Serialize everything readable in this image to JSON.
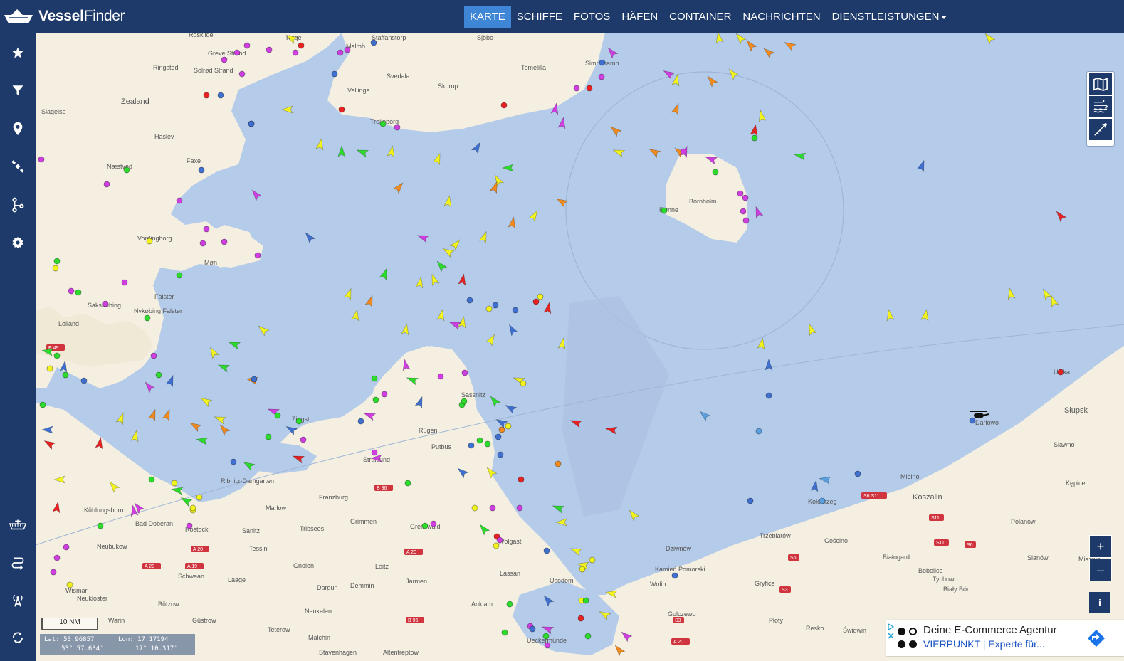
{
  "app": {
    "logo_text_bold": "Vessel",
    "logo_text": "Finder"
  },
  "nav": {
    "items": [
      {
        "label": "KARTE",
        "active": true
      },
      {
        "label": "SCHIFFE"
      },
      {
        "label": "FOTOS"
      },
      {
        "label": "HÄFEN"
      },
      {
        "label": "CONTAINER"
      },
      {
        "label": "NACHRICHTEN"
      },
      {
        "label": "DIENSTLEISTUNGEN"
      }
    ]
  },
  "sidebar": {
    "icons": [
      "star-icon",
      "filter-icon",
      "location-pin-icon",
      "satellite-icon",
      "route-icon",
      "gear-icon",
      "container-ship-icon",
      "route-planner-icon",
      "antenna-icon",
      "refresh-icon"
    ]
  },
  "map": {
    "water_color": "#b4cbe9",
    "land_color": "#f4efe1",
    "place_labels": [
      {
        "text": "Roskilde"
      },
      {
        "text": "Greve Strand"
      },
      {
        "text": "Solrød Strand"
      },
      {
        "text": "Køge"
      },
      {
        "text": "Ringsted"
      },
      {
        "text": "Zealand"
      },
      {
        "text": "Slagelse"
      },
      {
        "text": "Haslev"
      },
      {
        "text": "Næstved"
      },
      {
        "text": "Faxe"
      },
      {
        "text": "Vordingborg"
      },
      {
        "text": "Møn"
      },
      {
        "text": "Falster"
      },
      {
        "text": "Sakskøbing"
      },
      {
        "text": "Nykøbing Falster"
      },
      {
        "text": "Lolland"
      },
      {
        "text": "Malmö"
      },
      {
        "text": "Staffanstorp"
      },
      {
        "text": "Sjöbo"
      },
      {
        "text": "Svedala"
      },
      {
        "text": "Vellinge"
      },
      {
        "text": "Trelleborg"
      },
      {
        "text": "Skurup"
      },
      {
        "text": "Tomelilla"
      },
      {
        "text": "Simrishamn"
      },
      {
        "text": "Bornholm"
      },
      {
        "text": "Rønne"
      },
      {
        "text": "Rügen"
      },
      {
        "text": "Putbus"
      },
      {
        "text": "Sassnitz"
      },
      {
        "text": "Stralsund"
      },
      {
        "text": "Zingst"
      },
      {
        "text": "Ribnitz-Damgarten"
      },
      {
        "text": "Rostock"
      },
      {
        "text": "Bad Doberan"
      },
      {
        "text": "Kühlungsborn"
      },
      {
        "text": "Neubukow"
      },
      {
        "text": "Wismar"
      },
      {
        "text": "Neukloster"
      },
      {
        "text": "Warin"
      },
      {
        "text": "Bützow"
      },
      {
        "text": "Güstrow"
      },
      {
        "text": "Schwaan"
      },
      {
        "text": "Laage"
      },
      {
        "text": "Tessin"
      },
      {
        "text": "Sanitz"
      },
      {
        "text": "Marlow"
      },
      {
        "text": "Franzburg"
      },
      {
        "text": "Tribsees"
      },
      {
        "text": "Grimmen"
      },
      {
        "text": "Greifswald"
      },
      {
        "text": "Gnoien"
      },
      {
        "text": "Loitz"
      },
      {
        "text": "Dargun"
      },
      {
        "text": "Demmin"
      },
      {
        "text": "Jarmen"
      },
      {
        "text": "Neukalen"
      },
      {
        "text": "Teterow"
      },
      {
        "text": "Malchin"
      },
      {
        "text": "Stavenhagen"
      },
      {
        "text": "Altentreptow"
      },
      {
        "text": "Anklam"
      },
      {
        "text": "Lassan"
      },
      {
        "text": "Usedom"
      },
      {
        "text": "Ueckermünde"
      },
      {
        "text": "Wolgast"
      },
      {
        "text": "Wolin"
      },
      {
        "text": "Dziwnów"
      },
      {
        "text": "Kamień Pomorski"
      },
      {
        "text": "Golczewo"
      },
      {
        "text": "Gryfice"
      },
      {
        "text": "Płoty"
      },
      {
        "text": "Resko"
      },
      {
        "text": "Świdwin"
      },
      {
        "text": "Trzebiatów"
      },
      {
        "text": "Gościno"
      },
      {
        "text": "Kołobrzeg"
      },
      {
        "text": "Białogard"
      },
      {
        "text": "Mielno"
      },
      {
        "text": "Koszalin"
      },
      {
        "text": "Tychowo"
      },
      {
        "text": "Bobolice"
      },
      {
        "text": "Biały Bór"
      },
      {
        "text": "Polanów"
      },
      {
        "text": "Sianów"
      },
      {
        "text": "Sławno"
      },
      {
        "text": "Darłowo"
      },
      {
        "text": "Słupsk"
      },
      {
        "text": "Kępice"
      },
      {
        "text": "Miastko"
      },
      {
        "text": "Ustka"
      }
    ],
    "road_labels": [
      "A 20",
      "A 19",
      "A 20",
      "B 96",
      "A 20",
      "B 96",
      "E 49",
      "S6 S11",
      "S11",
      "S11",
      "S6",
      "S6",
      "S3",
      "S3",
      "A 20"
    ]
  },
  "scale": {
    "label": "10 NM"
  },
  "coords": {
    "lat_label": "Lat: 53.96857",
    "lat_dms": "53° 57.634'",
    "lon_label": "Lon: 17.17194",
    "lon_dms": "17° 10.317'"
  },
  "zoom": {
    "in": "+",
    "out": "–"
  },
  "info_button": {
    "label": "i"
  },
  "ad": {
    "title": "Deine E-Commerce Agentur",
    "subtitle": "VIERPUNKT | Experte für..."
  }
}
